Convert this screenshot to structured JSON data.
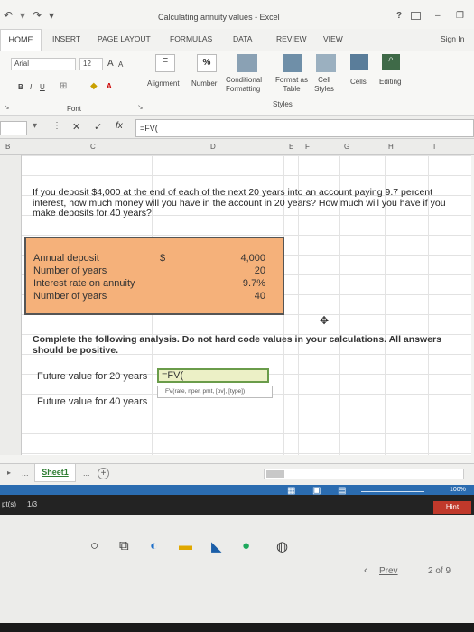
{
  "window": {
    "title": "Calculating annuity values - Excel",
    "help": "?",
    "sign_in": "Sign In"
  },
  "ribbon_tabs": [
    "HOME",
    "INSERT",
    "PAGE LAYOUT",
    "FORMULAS",
    "DATA",
    "REVIEW",
    "VIEW"
  ],
  "ribbon": {
    "font_name": "Arial",
    "font_size": "12",
    "font_group": "Font",
    "bold": "B",
    "italic": "I",
    "underline": "U",
    "grow": "A",
    "shrink": "A",
    "alignment": "Alignment",
    "number": "Number",
    "percent": "%",
    "conditional": "Conditional Formatting",
    "format_table": "Format as Table",
    "cell_styles": "Cell Styles",
    "styles_group": "Styles",
    "cells": "Cells",
    "editing": "Editing"
  },
  "formula_bar": {
    "fx": "fx",
    "content": "=FV("
  },
  "columns": [
    "B",
    "C",
    "D",
    "E",
    "F",
    "G",
    "H",
    "I"
  ],
  "question": "If you deposit $4,000 at the end of each of the next 20 years into an account paying 9.7 percent interest, how much money will you have in the account in 20 years? How much will you have if you make deposits for 40 years?",
  "inputs": {
    "rows": [
      {
        "label": "Annual deposit",
        "sym": "$",
        "value": "4,000"
      },
      {
        "label": "Number of years",
        "sym": "",
        "value": "20"
      },
      {
        "label": "Interest rate on annuity",
        "sym": "",
        "value": "9.7%"
      },
      {
        "label": "Number of years",
        "sym": "",
        "value": "40"
      }
    ]
  },
  "instructions": "Complete the following analysis. Do not hard code values in your calculations. All answers should be positive.",
  "analysis": {
    "fv20_label": "Future value for 20 years",
    "fv20_input": "=FV(",
    "tooltip": "FV(rate, nper, pmt, [pv], [type])",
    "fv40_label": "Future value for 40 years"
  },
  "sheet_tabs": {
    "ellipsis_left": "...",
    "sheet1": "Sheet1",
    "ellipsis_right": "...",
    "add": "+"
  },
  "status": {
    "zoom": "100%"
  },
  "lower": {
    "pts": "pt(s)",
    "page": "1/3",
    "hint": "Hint"
  },
  "pager": {
    "prev": "Prev",
    "counter": "2 of 9"
  }
}
